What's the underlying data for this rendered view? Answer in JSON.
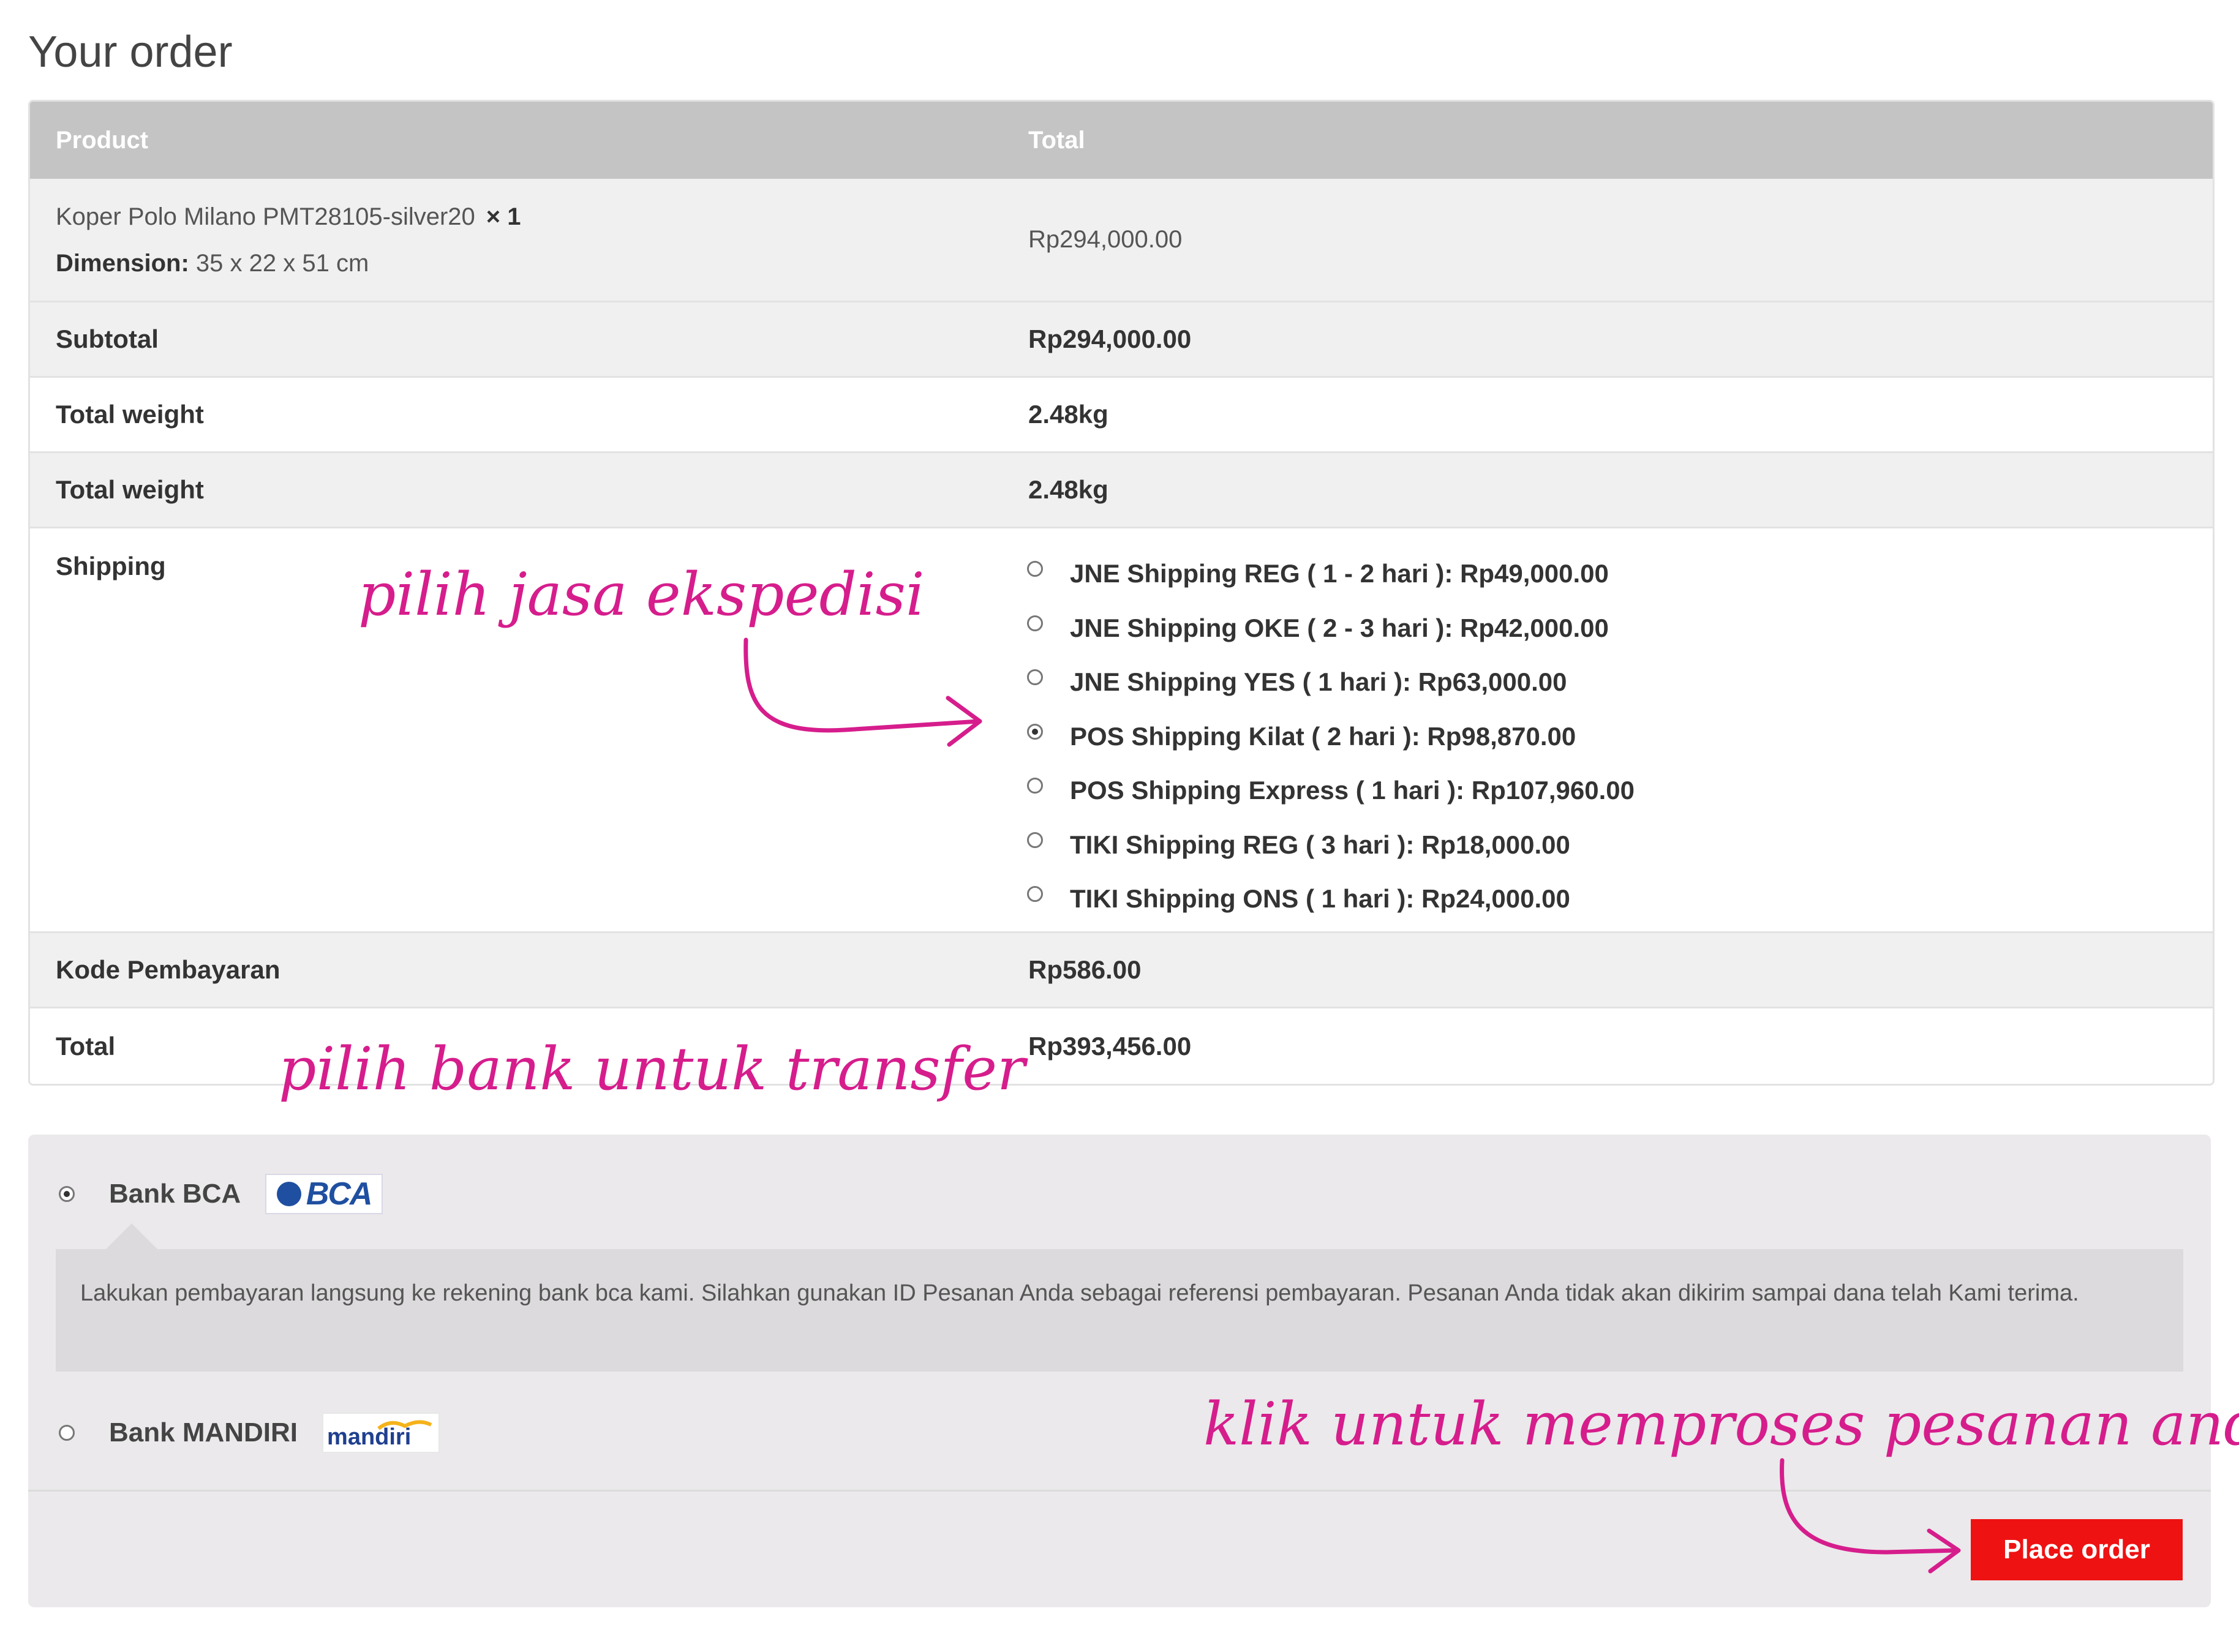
{
  "page": {
    "title": "Your order"
  },
  "table": {
    "headers": {
      "product": "Product",
      "total": "Total"
    },
    "item": {
      "name": "Koper Polo Milano PMT28105-silver20",
      "qty": "× 1",
      "dimension_label": "Dimension:",
      "dimension_value": "35 x 22 x 51 cm",
      "total": "Rp294,000.00"
    },
    "subtotal": {
      "label": "Subtotal",
      "value": "Rp294,000.00"
    },
    "weight1": {
      "label": "Total weight",
      "value": "2.48kg"
    },
    "weight2": {
      "label": "Total weight",
      "value": "2.48kg"
    },
    "shipping": {
      "label": "Shipping",
      "selected_index": 3,
      "options": [
        "JNE Shipping REG ( 1 - 2 hari ): Rp49,000.00",
        "JNE Shipping OKE ( 2 - 3 hari ): Rp42,000.00",
        "JNE Shipping YES ( 1 hari ): Rp63,000.00",
        "POS Shipping Kilat ( 2 hari ): Rp98,870.00",
        "POS Shipping Express ( 1 hari ): Rp107,960.00",
        "TIKI Shipping REG ( 3 hari ): Rp18,000.00",
        "TIKI Shipping ONS ( 1 hari ): Rp24,000.00"
      ]
    },
    "kode": {
      "label": "Kode Pembayaran",
      "value": "Rp586.00"
    },
    "total": {
      "label": "Total",
      "value": "Rp393,456.00"
    }
  },
  "payment": {
    "bca": {
      "label": "Bank BCA",
      "logo_text": "BCA",
      "selected": true
    },
    "bca_description": "Lakukan pembayaran langsung ke rekening bank bca kami. Silahkan gunakan ID Pesanan Anda sebagai referensi pembayaran. Pesanan Anda tidak akan dikirim sampai dana telah Kami terima.",
    "mandiri": {
      "label": "Bank MANDIRI",
      "logo_text": "mandiri",
      "selected": false
    },
    "place_order": "Place order"
  },
  "annotations": {
    "shipping": "pilih jasa ekspedisi",
    "bank": "pilih bank untuk transfer",
    "order": "klik untuk memproses pesanan anda"
  },
  "colors": {
    "annotation": "#d61d8c",
    "place_order": "#ee1212",
    "header_bg": "#c4c4c4"
  }
}
